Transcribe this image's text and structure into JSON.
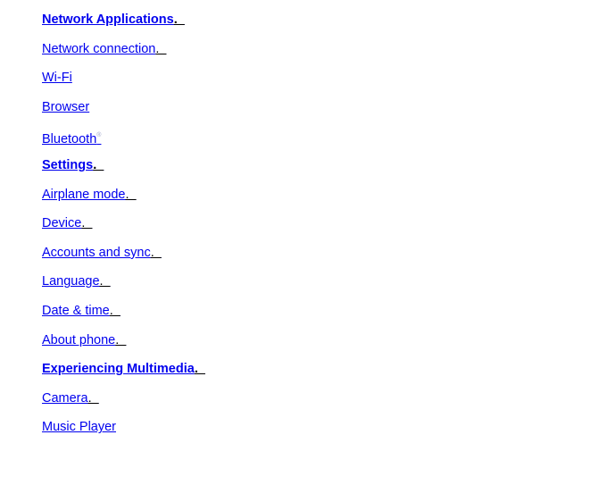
{
  "toc": {
    "items": [
      {
        "label": "Network Applications",
        "tail": ".  ",
        "bold": true
      },
      {
        "label": "Network connection",
        "tail": ".  ",
        "bold": false
      },
      {
        "label": "Wi-Fi",
        "tail": "",
        "bold": false
      },
      {
        "label": "Browser",
        "tail": "",
        "bold": false
      },
      {
        "label": "Bluetooth",
        "tail": "",
        "sup": "®",
        "bold": false
      },
      {
        "label": "Settings",
        "tail": ".  ",
        "bold": true
      },
      {
        "label": "Airplane mode",
        "tail": ".  ",
        "bold": false
      },
      {
        "label": "Device",
        "tail": ".  ",
        "bold": false
      },
      {
        "label": "Accounts and sync",
        "tail": ".  ",
        "bold": false
      },
      {
        "label": "Language",
        "tail": ".  ",
        "bold": false
      },
      {
        "label": "Date & time",
        "tail": ".  ",
        "bold": false
      },
      {
        "label": "About phone",
        "tail": ".  ",
        "bold": false
      },
      {
        "label": "Experiencing Multimedia",
        "tail": ".  ",
        "bold": true
      },
      {
        "label": "Camera",
        "tail": ".  ",
        "bold": false
      },
      {
        "label": "Music Player",
        "tail": "",
        "bold": false
      }
    ]
  },
  "colors": {
    "link": "#0000ee",
    "tail": "#000000",
    "background": "#ffffff"
  }
}
